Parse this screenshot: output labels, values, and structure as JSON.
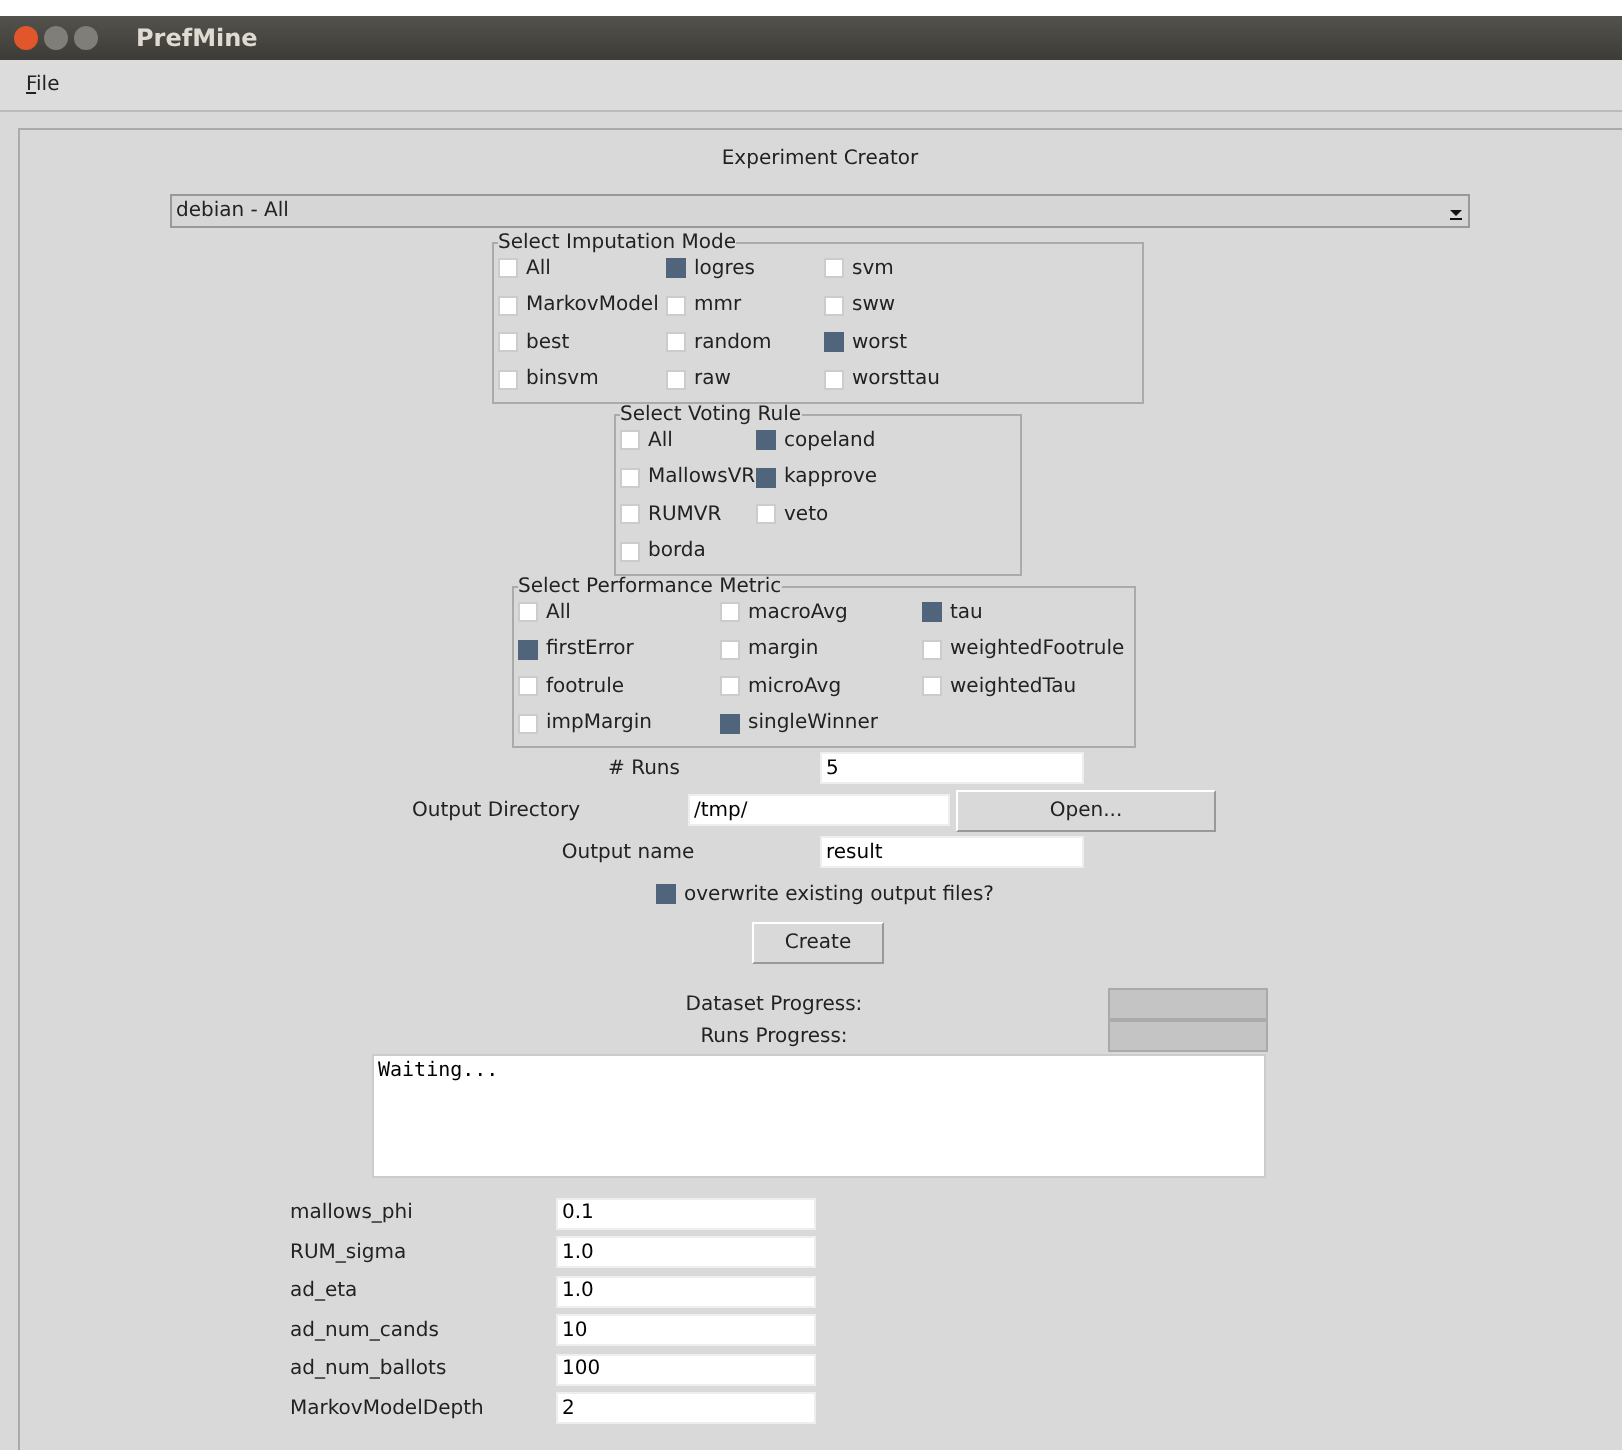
{
  "window": {
    "title": "PrefMine"
  },
  "menu": [
    {
      "label": "File"
    }
  ],
  "heading": "Experiment Creator",
  "dataset_select": {
    "value": "debian - All"
  },
  "imputation": {
    "legend": "Select Imputation Mode",
    "options": [
      {
        "label": "All",
        "checked": false
      },
      {
        "label": "logres",
        "checked": true
      },
      {
        "label": "svm",
        "checked": false
      },
      {
        "label": "MarkovModel",
        "checked": false
      },
      {
        "label": "mmr",
        "checked": false
      },
      {
        "label": "sww",
        "checked": false
      },
      {
        "label": "best",
        "checked": false
      },
      {
        "label": "random",
        "checked": false
      },
      {
        "label": "worst",
        "checked": true
      },
      {
        "label": "binsvm",
        "checked": false
      },
      {
        "label": "raw",
        "checked": false
      },
      {
        "label": "worsttau",
        "checked": false
      }
    ]
  },
  "voting": {
    "legend": "Select Voting Rule",
    "options": [
      {
        "label": "All",
        "checked": false
      },
      {
        "label": "copeland",
        "checked": true
      },
      {
        "label": "MallowsVR",
        "checked": false
      },
      {
        "label": "kapprove",
        "checked": true
      },
      {
        "label": "RUMVR",
        "checked": false
      },
      {
        "label": "veto",
        "checked": false
      },
      {
        "label": "borda",
        "checked": false
      }
    ]
  },
  "metric": {
    "legend": "Select Performance Metric",
    "options": [
      {
        "label": "All",
        "checked": false
      },
      {
        "label": "macroAvg",
        "checked": false
      },
      {
        "label": "tau",
        "checked": true
      },
      {
        "label": "firstError",
        "checked": true
      },
      {
        "label": "margin",
        "checked": false
      },
      {
        "label": "weightedFootrule",
        "checked": false
      },
      {
        "label": "footrule",
        "checked": false
      },
      {
        "label": "microAvg",
        "checked": false
      },
      {
        "label": "weightedTau",
        "checked": false
      },
      {
        "label": "impMargin",
        "checked": false
      },
      {
        "label": "singleWinner",
        "checked": true
      }
    ]
  },
  "runs": {
    "label": "# Runs",
    "value": "5"
  },
  "output_directory": {
    "label": "Output Directory",
    "value": "/tmp/",
    "button": "Open..."
  },
  "output_name": {
    "label": "Output name",
    "value": "result"
  },
  "overwrite": {
    "label": "overwrite existing output files?",
    "checked": true
  },
  "create_button": "Create",
  "progress": [
    {
      "label": "Dataset Progress:",
      "level": 0
    },
    {
      "label": "Runs Progress:",
      "level": 0
    }
  ],
  "log": "Waiting...",
  "params": [
    {
      "label": "mallows_phi",
      "value": "0.1"
    },
    {
      "label": "RUM_sigma",
      "value": "1.0"
    },
    {
      "label": "ad_eta",
      "value": "1.0"
    },
    {
      "label": "ad_num_cands",
      "value": "10"
    },
    {
      "label": "ad_num_ballots",
      "value": "100"
    },
    {
      "label": "MarkovModelDepth",
      "value": "2"
    }
  ]
}
